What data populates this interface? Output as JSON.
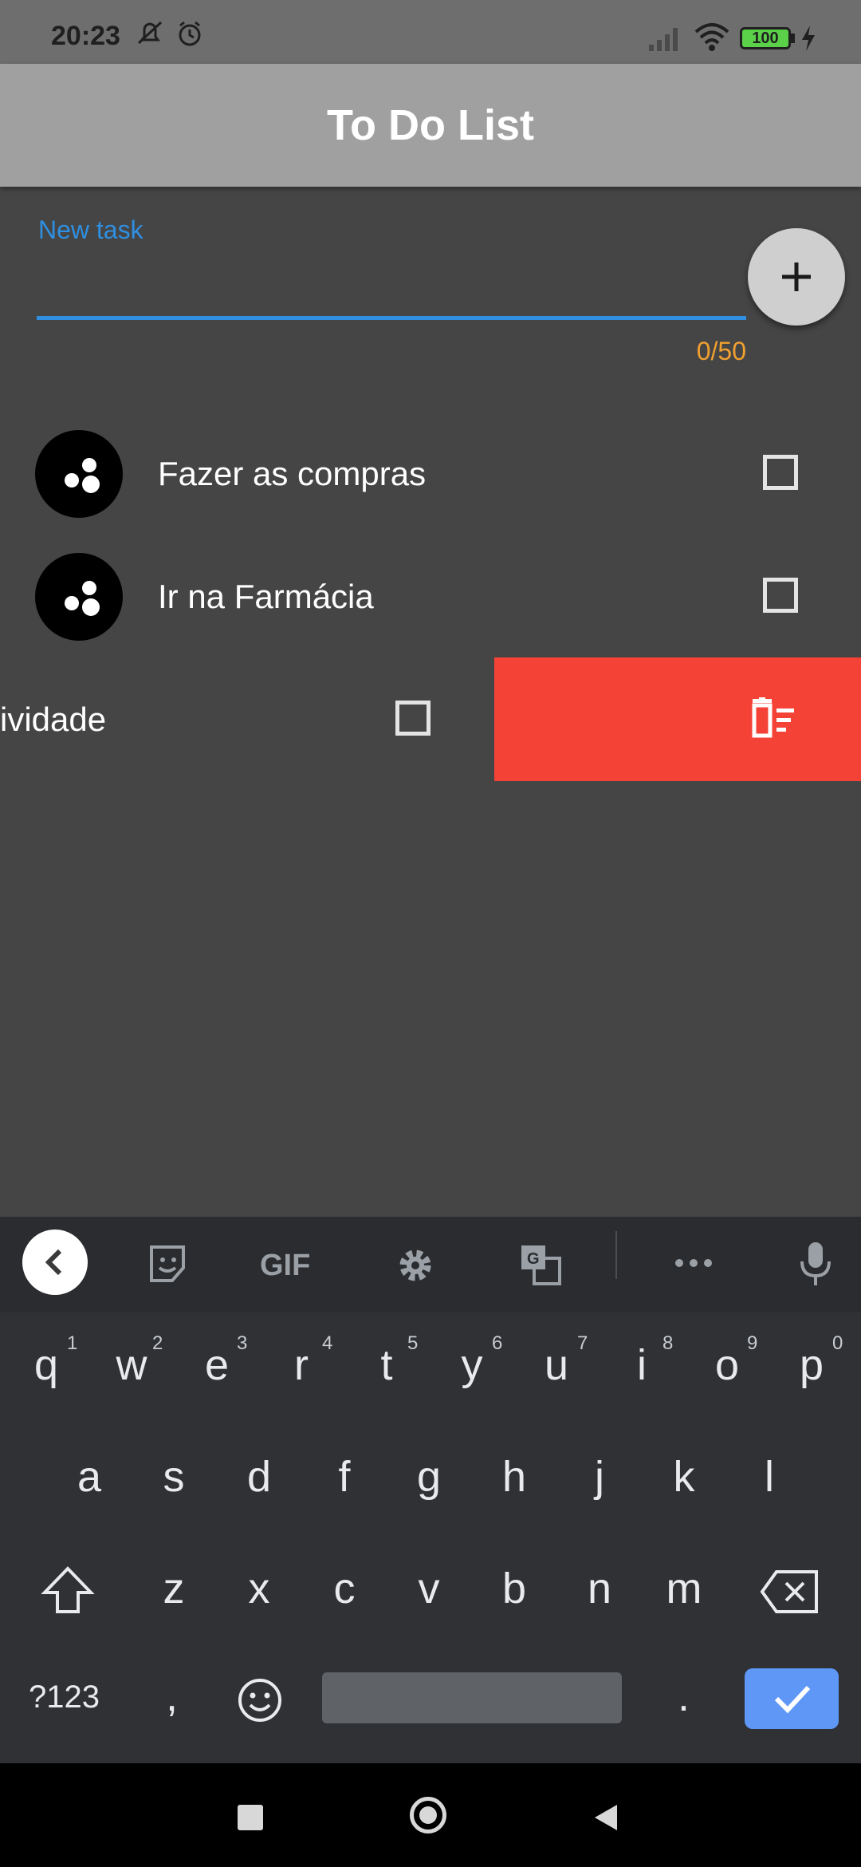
{
  "status_bar": {
    "time": "20:23",
    "battery": "100"
  },
  "app_bar": {
    "title": "To Do List"
  },
  "new_task": {
    "label": "New task",
    "value": "",
    "counter": "0/50"
  },
  "tasks": [
    {
      "text": "Fazer as compras",
      "checked": false
    },
    {
      "text": "Ir na Farmácia",
      "checked": false
    },
    {
      "text": "ividade",
      "checked": false
    }
  ],
  "colors": {
    "accent": "#2f8fe0",
    "counter": "#f0a030",
    "delete": "#f44236"
  },
  "keyboard": {
    "toolbar": [
      "back-icon",
      "sticker-icon",
      "GIF",
      "settings-icon",
      "translate-icon",
      "more-icon",
      "mic-icon"
    ],
    "gif_label": "GIF",
    "row1": [
      "q",
      "w",
      "e",
      "r",
      "t",
      "y",
      "u",
      "i",
      "o",
      "p"
    ],
    "row1_hints": [
      "1",
      "2",
      "3",
      "4",
      "5",
      "6",
      "7",
      "8",
      "9",
      "0"
    ],
    "row2": [
      "a",
      "s",
      "d",
      "f",
      "g",
      "h",
      "j",
      "k",
      "l"
    ],
    "row3": [
      "z",
      "x",
      "c",
      "v",
      "b",
      "n",
      "m"
    ],
    "symbols": "?123",
    "comma": ",",
    "period": "."
  }
}
